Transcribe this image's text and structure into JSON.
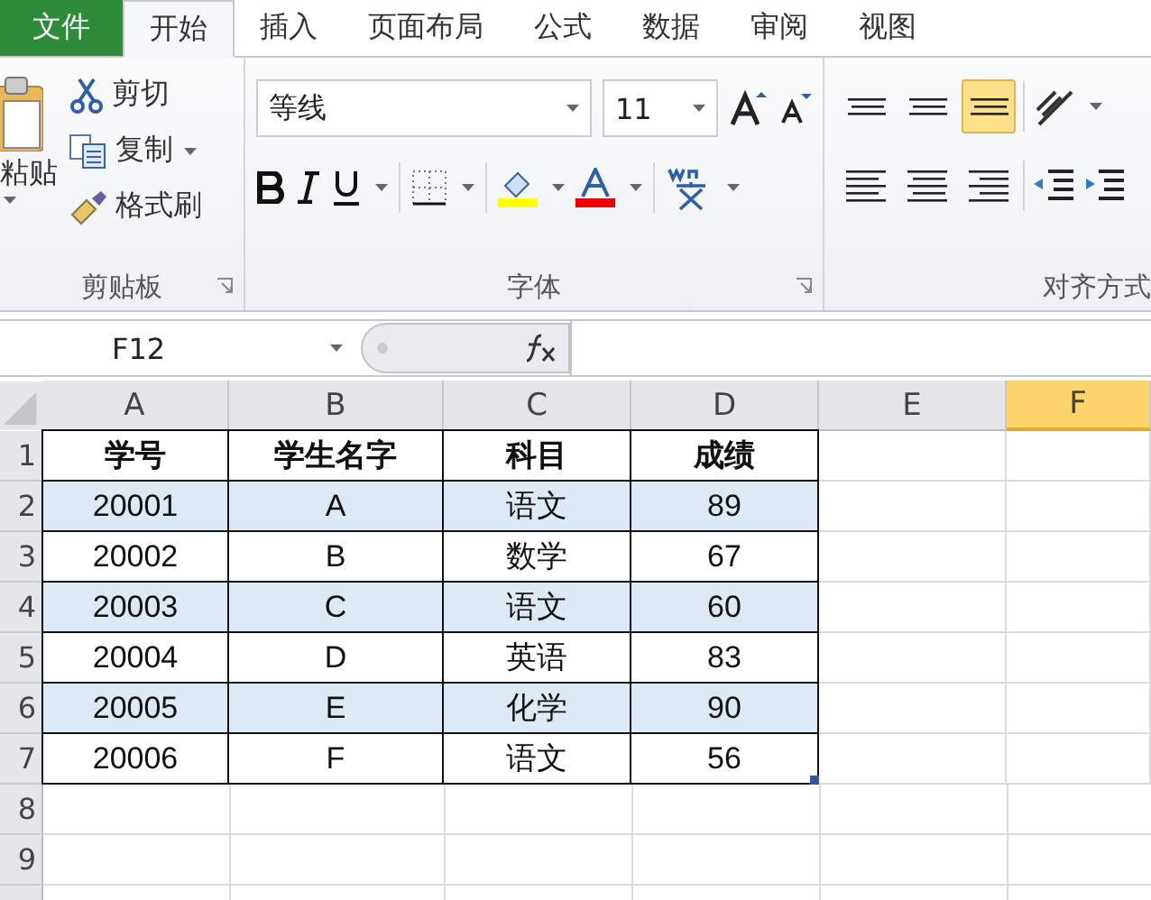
{
  "tabs": [
    {
      "label": "文件",
      "kind": "file",
      "selected": false
    },
    {
      "label": "开始",
      "kind": "tab",
      "selected": true
    },
    {
      "label": "插入",
      "kind": "tab",
      "selected": false
    },
    {
      "label": "页面布局",
      "kind": "tab",
      "selected": false
    },
    {
      "label": "公式",
      "kind": "tab",
      "selected": false
    },
    {
      "label": "数据",
      "kind": "tab",
      "selected": false
    },
    {
      "label": "审阅",
      "kind": "tab",
      "selected": false
    },
    {
      "label": "视图",
      "kind": "tab",
      "selected": false
    }
  ],
  "clipboard": {
    "paste_label": "粘贴",
    "items": [
      {
        "label": "剪切",
        "kind": "cut",
        "dropdown": false
      },
      {
        "label": "复制",
        "kind": "copy",
        "dropdown": true
      },
      {
        "label": "格式刷",
        "kind": "painter",
        "dropdown": false
      }
    ],
    "group_label": "剪贴板"
  },
  "font": {
    "font_name": "等线",
    "font_size": "11",
    "group_label": "字体"
  },
  "alignment": {
    "buttons": [
      {
        "kind": "top",
        "selected": false
      },
      {
        "kind": "middle",
        "selected": false
      },
      {
        "kind": "bottom",
        "selected": true
      },
      {
        "kind": "left",
        "selected": false
      },
      {
        "kind": "center",
        "selected": false
      },
      {
        "kind": "right",
        "selected": false
      }
    ],
    "group_label": "对齐方式"
  },
  "formula_bar": {
    "name_box": "F12"
  },
  "sheet": {
    "columns": [
      {
        "label": "A",
        "selected": false
      },
      {
        "label": "B",
        "selected": false
      },
      {
        "label": "C",
        "selected": false
      },
      {
        "label": "D",
        "selected": false
      },
      {
        "label": "E",
        "selected": false
      },
      {
        "label": "F",
        "selected": true
      }
    ],
    "rows": [
      {
        "number": "1",
        "kind": "header",
        "shaded": false,
        "cells": [
          "学号",
          "学生名字",
          "科目",
          "成绩"
        ]
      },
      {
        "number": "2",
        "kind": "data",
        "shaded": true,
        "cells": [
          "20001",
          "A",
          "语文",
          "89"
        ]
      },
      {
        "number": "3",
        "kind": "data",
        "shaded": false,
        "cells": [
          "20002",
          "B",
          "数学",
          "67"
        ]
      },
      {
        "number": "4",
        "kind": "data",
        "shaded": true,
        "cells": [
          "20003",
          "C",
          "语文",
          "60"
        ]
      },
      {
        "number": "5",
        "kind": "data",
        "shaded": false,
        "cells": [
          "20004",
          "D",
          "英语",
          "83"
        ]
      },
      {
        "number": "6",
        "kind": "data",
        "shaded": true,
        "cells": [
          "20005",
          "E",
          "化学",
          "90"
        ]
      },
      {
        "number": "7",
        "kind": "data",
        "shaded": false,
        "cells": [
          "20006",
          "F",
          "语文",
          "56"
        ]
      },
      {
        "number": "8",
        "kind": "empty",
        "cells": []
      },
      {
        "number": "9",
        "kind": "empty",
        "cells": []
      },
      {
        "number": "",
        "kind": "empty",
        "cells": []
      }
    ]
  }
}
